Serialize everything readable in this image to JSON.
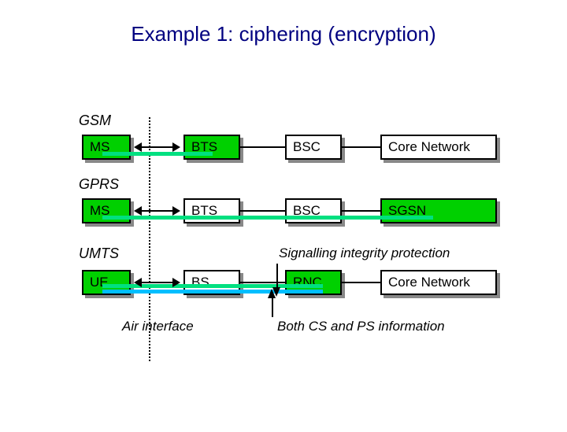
{
  "title": "Example 1: ciphering (encryption)",
  "rows": {
    "gsm": {
      "label": "GSM",
      "b1": "MS",
      "b2": "BTS",
      "b3": "BSC",
      "b4": "Core Network"
    },
    "gprs": {
      "label": "GPRS",
      "b1": "MS",
      "b2": "BTS",
      "b3": "BSC",
      "b4": "SGSN"
    },
    "umts": {
      "label": "UMTS",
      "b1": "UE",
      "b2": "BS",
      "b3": "RNC",
      "b4": "Core Network"
    }
  },
  "notes": {
    "sig": "Signalling integrity protection",
    "air": "Air interface",
    "both": "Both CS and PS information"
  }
}
